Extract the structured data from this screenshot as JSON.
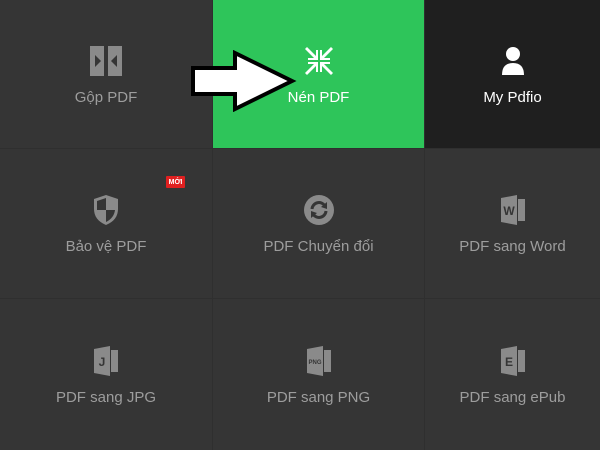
{
  "tiles": {
    "merge": {
      "label": "Gộp PDF",
      "icon": "merge-icon"
    },
    "compress": {
      "label": "Nén PDF",
      "icon": "compress-icon"
    },
    "account": {
      "label": "My Pdfio",
      "icon": "user-icon"
    },
    "protect": {
      "label": "Bảo vệ PDF",
      "icon": "shield-icon",
      "badge": "MỚI"
    },
    "convert": {
      "label": "PDF Chuyển đổi",
      "icon": "convert-icon"
    },
    "to_word": {
      "label": "PDF sang Word",
      "icon": "word-file-icon"
    },
    "to_jpg": {
      "label": "PDF sang JPG",
      "icon": "jpg-file-icon"
    },
    "to_png": {
      "label": "PDF sang PNG",
      "icon": "png-file-icon"
    },
    "to_epub": {
      "label": "PDF sang ePub",
      "icon": "epub-file-icon"
    }
  },
  "colors": {
    "active": "#2ec55a",
    "tile": "#353535",
    "gap": "#2f2f2f",
    "account": "#1f1f1f",
    "badge": "#e02020"
  },
  "annotation": {
    "icon": "arrow-right-icon"
  }
}
